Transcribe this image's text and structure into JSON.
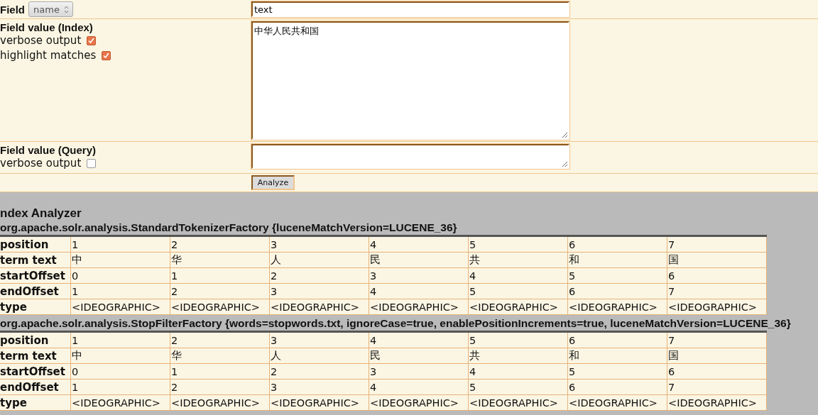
{
  "form": {
    "field": {
      "label": "Field",
      "select_value": "name",
      "input_value": "text"
    },
    "index": {
      "label": "Field value (Index)",
      "options": [
        {
          "label": "verbose output",
          "checked": true
        },
        {
          "label": "highlight matches",
          "checked": true
        }
      ],
      "value": "中华人民共和国"
    },
    "query": {
      "label": "Field value (Query)",
      "options": [
        {
          "label": "verbose output",
          "checked": false
        }
      ]
    },
    "button": "Analyze"
  },
  "analyzer": {
    "title": "ndex Analyzer",
    "stages": [
      {
        "name": "org.apache.solr.analysis.StandardTokenizerFactory {luceneMatchVersion=LUCENE_36}",
        "rows": [
          {
            "label": "position",
            "cells": [
              "1",
              "2",
              "3",
              "4",
              "5",
              "6",
              "7"
            ]
          },
          {
            "label": "term text",
            "cells": [
              "中",
              "华",
              "人",
              "民",
              "共",
              "和",
              "国"
            ]
          },
          {
            "label": "startOffset",
            "cells": [
              "0",
              "1",
              "2",
              "3",
              "4",
              "5",
              "6"
            ]
          },
          {
            "label": "endOffset",
            "cells": [
              "1",
              "2",
              "3",
              "4",
              "5",
              "6",
              "7"
            ]
          },
          {
            "label": "type",
            "cells": [
              "<IDEOGRAPHIC>",
              "<IDEOGRAPHIC>",
              "<IDEOGRAPHIC>",
              "<IDEOGRAPHIC>",
              "<IDEOGRAPHIC>",
              "<IDEOGRAPHIC>",
              "<IDEOGRAPHIC>"
            ]
          }
        ]
      },
      {
        "name": "org.apache.solr.analysis.StopFilterFactory {words=stopwords.txt, ignoreCase=true, enablePositionIncrements=true, luceneMatchVersion=LUCENE_36}",
        "rows": [
          {
            "label": "position",
            "cells": [
              "1",
              "2",
              "3",
              "4",
              "5",
              "6",
              "7"
            ]
          },
          {
            "label": "term text",
            "cells": [
              "中",
              "华",
              "人",
              "民",
              "共",
              "和",
              "国"
            ]
          },
          {
            "label": "startOffset",
            "cells": [
              "0",
              "1",
              "2",
              "3",
              "4",
              "5",
              "6"
            ]
          },
          {
            "label": "endOffset",
            "cells": [
              "1",
              "2",
              "3",
              "4",
              "5",
              "6",
              "7"
            ]
          },
          {
            "label": "type",
            "cells": [
              "<IDEOGRAPHIC>",
              "<IDEOGRAPHIC>",
              "<IDEOGRAPHIC>",
              "<IDEOGRAPHIC>",
              "<IDEOGRAPHIC>",
              "<IDEOGRAPHIC>",
              "<IDEOGRAPHIC>"
            ]
          }
        ]
      }
    ]
  }
}
